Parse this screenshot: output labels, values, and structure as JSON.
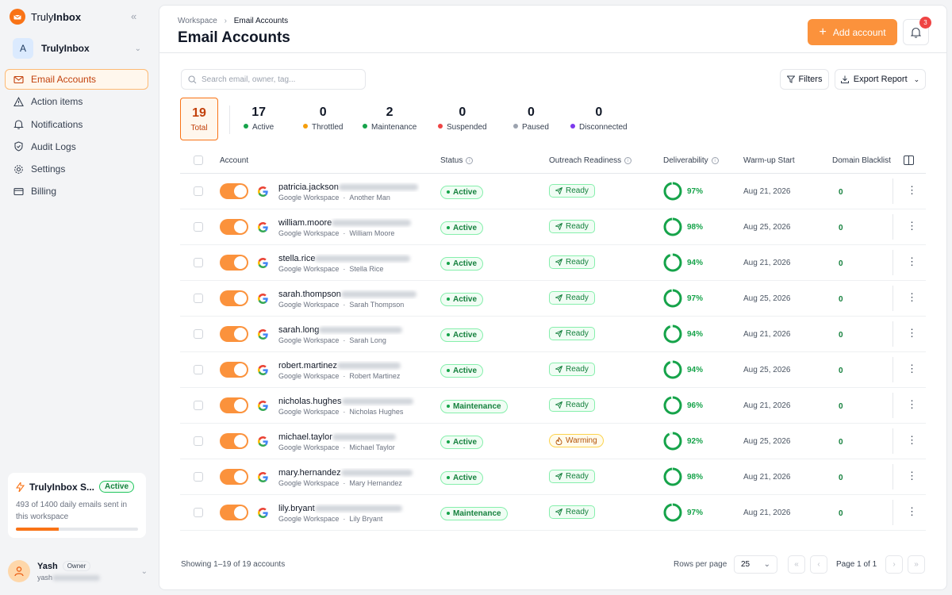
{
  "brand": {
    "prefix": "Truly",
    "bold": "Inbox"
  },
  "workspace": {
    "initial": "A",
    "name": "TrulyInbox"
  },
  "nav": [
    {
      "label": "Email Accounts",
      "icon": "mail-icon",
      "active": true
    },
    {
      "label": "Action items",
      "icon": "warning-icon",
      "active": false
    },
    {
      "label": "Notifications",
      "icon": "bell-icon",
      "active": false
    },
    {
      "label": "Audit Logs",
      "icon": "shield-icon",
      "active": false
    },
    {
      "label": "Settings",
      "icon": "gear-icon",
      "active": false
    },
    {
      "label": "Billing",
      "icon": "card-icon",
      "active": false
    }
  ],
  "plan": {
    "title": "TrulyInbox S...",
    "status": "Active",
    "text": "493 of 1400 daily emails sent in this workspace",
    "progress": 0.352
  },
  "user": {
    "name": "Yash",
    "role": "Owner",
    "email_prefix": "yash"
  },
  "breadcrumb": {
    "root": "Workspace",
    "current": "Email Accounts"
  },
  "page_title": "Email Accounts",
  "add_button": "Add account",
  "notifications_count": "3",
  "search": {
    "placeholder": "Search email, owner, tag..."
  },
  "filters_label": "Filters",
  "export_label": "Export Report",
  "stats": {
    "total": {
      "value": "19",
      "label": "Total"
    },
    "items": [
      {
        "value": "17",
        "label": "Active",
        "color": "#16a34a"
      },
      {
        "value": "0",
        "label": "Throttled",
        "color": "#f59e0b"
      },
      {
        "value": "2",
        "label": "Maintenance",
        "color": "#16a34a"
      },
      {
        "value": "0",
        "label": "Suspended",
        "color": "#ef4444"
      },
      {
        "value": "0",
        "label": "Paused",
        "color": "#9ca3af"
      },
      {
        "value": "0",
        "label": "Disconnected",
        "color": "#7c3aed"
      }
    ]
  },
  "columns": {
    "account": "Account",
    "status": "Status",
    "readiness": "Outreach Readiness",
    "deliverability": "Deliverability",
    "warmup": "Warm-up Start",
    "blacklist": "Domain Blacklist"
  },
  "rows": [
    {
      "email": "patricia.jackson",
      "provider": "Google Workspace",
      "owner": "Another Man",
      "status": "Active",
      "readiness": "Ready",
      "deliverability": 97,
      "deliverability_label": "97%",
      "warmup": "Aug 21, 2026",
      "blacklist": "0"
    },
    {
      "email": "william.moore",
      "provider": "Google Workspace",
      "owner": "William Moore",
      "status": "Active",
      "readiness": "Ready",
      "deliverability": 98,
      "deliverability_label": "98%",
      "warmup": "Aug 25, 2026",
      "blacklist": "0"
    },
    {
      "email": "stella.rice",
      "provider": "Google Workspace",
      "owner": "Stella Rice",
      "status": "Active",
      "readiness": "Ready",
      "deliverability": 94,
      "deliverability_label": "94%",
      "warmup": "Aug 21, 2026",
      "blacklist": "0"
    },
    {
      "email": "sarah.thompson",
      "provider": "Google Workspace",
      "owner": "Sarah Thompson",
      "status": "Active",
      "readiness": "Ready",
      "deliverability": 97,
      "deliverability_label": "97%",
      "warmup": "Aug 25, 2026",
      "blacklist": "0"
    },
    {
      "email": "sarah.long",
      "provider": "Google Workspace",
      "owner": "Sarah Long",
      "status": "Active",
      "readiness": "Ready",
      "deliverability": 94,
      "deliverability_label": "94%",
      "warmup": "Aug 21, 2026",
      "blacklist": "0"
    },
    {
      "email": "robert.martinez",
      "provider": "Google Workspace",
      "owner": "Robert Martinez",
      "status": "Active",
      "readiness": "Ready",
      "deliverability": 94,
      "deliverability_label": "94%",
      "warmup": "Aug 25, 2026",
      "blacklist": "0"
    },
    {
      "email": "nicholas.hughes",
      "provider": "Google Workspace",
      "owner": "Nicholas Hughes",
      "status": "Maintenance",
      "readiness": "Ready",
      "deliverability": 96,
      "deliverability_label": "96%",
      "warmup": "Aug 21, 2026",
      "blacklist": "0"
    },
    {
      "email": "michael.taylor",
      "provider": "Google Workspace",
      "owner": "Michael Taylor",
      "status": "Active",
      "readiness": "Warming",
      "deliverability": 92,
      "deliverability_label": "92%",
      "warmup": "Aug 25, 2026",
      "blacklist": "0"
    },
    {
      "email": "mary.hernandez",
      "provider": "Google Workspace",
      "owner": "Mary Hernandez",
      "status": "Active",
      "readiness": "Ready",
      "deliverability": 98,
      "deliverability_label": "98%",
      "warmup": "Aug 21, 2026",
      "blacklist": "0"
    },
    {
      "email": "lily.bryant",
      "provider": "Google Workspace",
      "owner": "Lily Bryant",
      "status": "Maintenance",
      "readiness": "Ready",
      "deliverability": 97,
      "deliverability_label": "97%",
      "warmup": "Aug 21, 2026",
      "blacklist": "0"
    }
  ],
  "footer": {
    "showing": "Showing 1–19 of 19 accounts",
    "rows_per_page_label": "Rows per page",
    "rows_per_page": "25",
    "page": "Page 1 of 1"
  },
  "colors": {
    "accent": "#f97316",
    "success": "#16a34a"
  }
}
